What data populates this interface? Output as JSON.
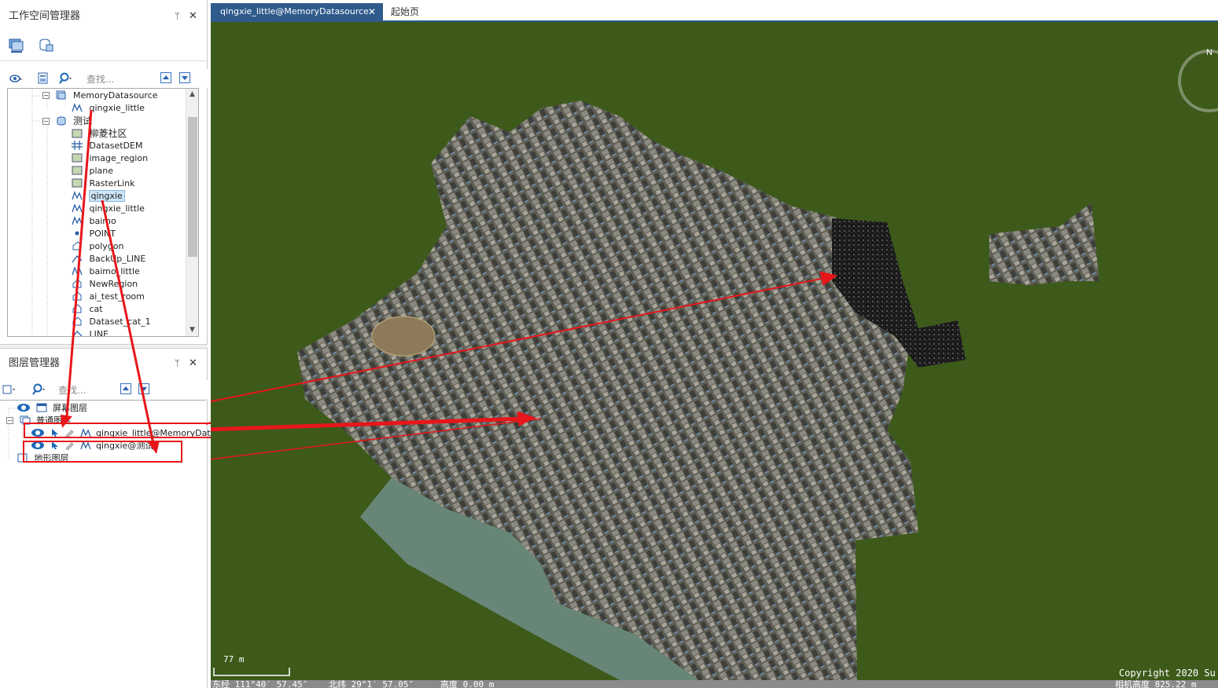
{
  "workspace_panel": {
    "title": "工作空间管理器",
    "pin_glyph": "ᛘ",
    "close_glyph": "✕",
    "search_placeholder": "查找...",
    "tree": [
      {
        "label": "MemoryDatasource",
        "kind": "datasource"
      },
      {
        "label": "qingxie_little",
        "kind": "line"
      },
      {
        "label": "测试",
        "kind": "datasource"
      },
      {
        "label": "柳菱社区",
        "kind": "image"
      },
      {
        "label": "DatasetDEM",
        "kind": "grid"
      },
      {
        "label": "image_region",
        "kind": "image"
      },
      {
        "label": "plane",
        "kind": "image"
      },
      {
        "label": "RasterLink",
        "kind": "image"
      },
      {
        "label": "qingxie",
        "kind": "line",
        "selected": true
      },
      {
        "label": "qingxie_little",
        "kind": "line"
      },
      {
        "label": "baimo",
        "kind": "line"
      },
      {
        "label": "POINT",
        "kind": "point"
      },
      {
        "label": "polygon",
        "kind": "region"
      },
      {
        "label": "BackUp_LINE",
        "kind": "linedash"
      },
      {
        "label": "baimo_little",
        "kind": "line"
      },
      {
        "label": "NewRegion",
        "kind": "region"
      },
      {
        "label": "ai_test_room",
        "kind": "region"
      },
      {
        "label": "cat",
        "kind": "region"
      },
      {
        "label": "Dataset_cat_1",
        "kind": "region"
      },
      {
        "label": "LINE",
        "kind": "linedash"
      }
    ]
  },
  "layer_panel": {
    "title": "图层管理器",
    "pin_glyph": "ᛘ",
    "close_glyph": "✕",
    "search_placeholder": "查找...",
    "groups": [
      {
        "label": "屏幕图层"
      },
      {
        "label": "普通图层"
      },
      {
        "label": "qingxie_little@MemoryDatasource"
      },
      {
        "label": "qingxie@测试"
      },
      {
        "label": "地形图层"
      }
    ]
  },
  "map_window": {
    "tabs": [
      {
        "label": "qingxie_little@MemoryDatasource",
        "active": true
      },
      {
        "label": "起始页",
        "active": false
      }
    ],
    "tab_close_glyph": "✕",
    "compass_label": "N",
    "scale_text": "77 m",
    "copyright": "Copyright 2020 Su",
    "status": {
      "longitude": "东经 111°40′ 57.45″",
      "latitude": "北纬 29°1′ 57.05″",
      "height": "高度 0.00 m",
      "camera_height": "相机高度 825.22 m"
    }
  },
  "colors": {
    "ground": "#3d5a1a",
    "tab_active": "#2f5a8c",
    "annotation_red": "#e8161b",
    "selection": "#cce4f7"
  }
}
